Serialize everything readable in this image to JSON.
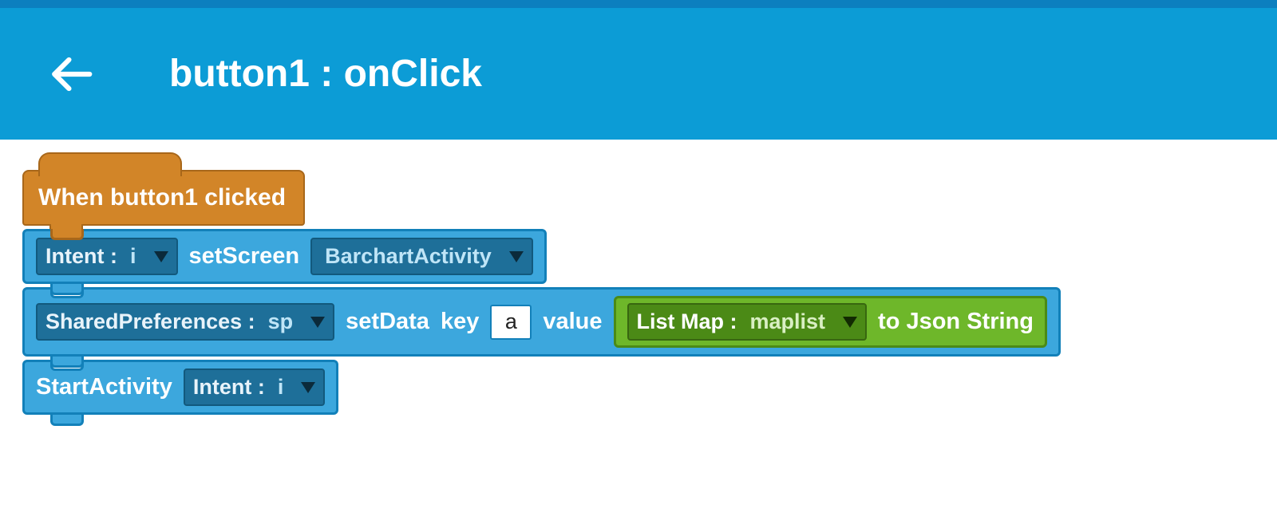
{
  "header": {
    "title": "button1 : onClick"
  },
  "hat": {
    "text": "When  button1 clicked"
  },
  "rows": {
    "intentSetScreen": {
      "slot1_label": "Intent :",
      "slot1_value": "i",
      "action": "setScreen",
      "slot2_value": "BarchartActivity"
    },
    "sharedPrefSetData": {
      "slot1_label": "SharedPreferences :",
      "slot1_value": "sp",
      "action": "setData",
      "key_label": "key",
      "key_value": "a",
      "value_label": "value",
      "green": {
        "slot_label": "List Map :",
        "slot_value": "maplist",
        "tail": "to  Json  String"
      }
    },
    "startActivity": {
      "action": "StartActivity",
      "slot_label": "Intent :",
      "slot_value": "i"
    }
  }
}
